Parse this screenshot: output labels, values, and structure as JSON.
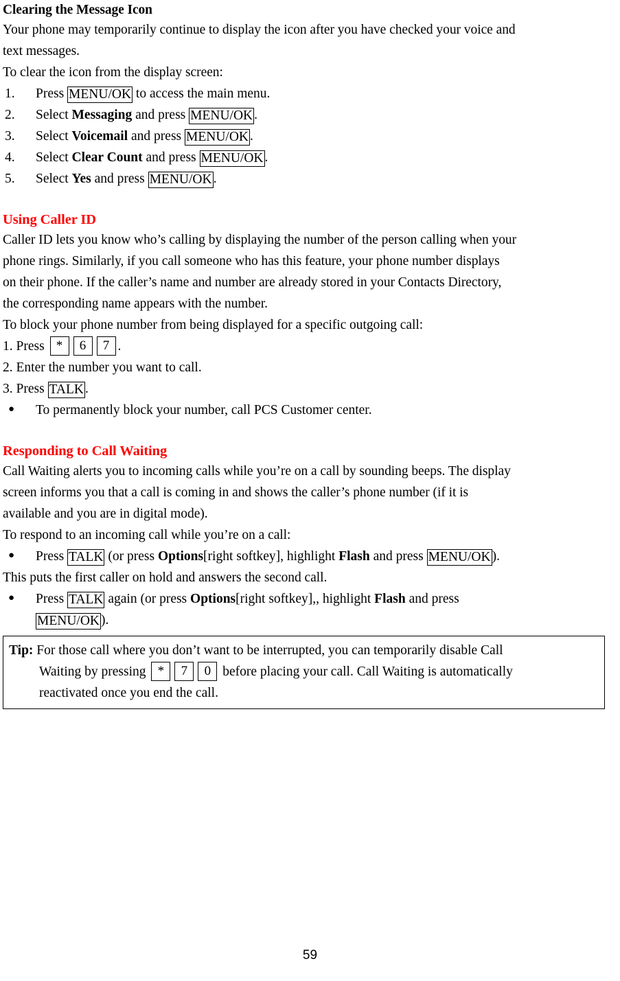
{
  "document": {
    "page_number": "59"
  },
  "sections": [
    {
      "heading": "Clearing the Message Icon",
      "heading_color": "#000000"
    },
    {
      "heading": "Using Caller ID",
      "heading_color": "#FF0000"
    },
    {
      "heading": "Responding to Call Waiting",
      "heading_color": "#FF0000"
    }
  ],
  "clearing_message_icon": {
    "heading": "Clearing the Message Icon",
    "intro_line1": "Your phone may temporarily continue to display the icon after you have checked your voice and",
    "intro_line2": "text messages.",
    "lead_in": "To clear the icon from the display screen:",
    "steps": [
      {
        "num": "1.",
        "pre": "Press ",
        "key": "MENU/OK",
        "post": " to access the main menu."
      },
      {
        "num": "2.",
        "pre": "Select ",
        "bold": "Messaging",
        "mid": " and press ",
        "key": "MENU/OK",
        "post": "."
      },
      {
        "num": "3.",
        "pre": "Select ",
        "bold": "Voicemail",
        "mid": " and press ",
        "key": "MENU/OK",
        "post": "."
      },
      {
        "num": "4.",
        "pre": "Select ",
        "bold": "Clear Count",
        "mid": " and press ",
        "key": "MENU/OK",
        "post": "."
      },
      {
        "num": "5.",
        "pre": "Select ",
        "bold": "Yes",
        "mid": " and press ",
        "key": "MENU/OK",
        "post": "."
      }
    ]
  },
  "using_caller_id": {
    "heading": "Using Caller ID",
    "body_line1": "Caller ID lets you know who’s calling by displaying the number of the person calling when your",
    "body_line2": "phone rings. Similarly, if you call someone who has this feature, your phone number displays",
    "body_line3": "on their phone. If the caller’s name and number are already stored in your Contacts Directory,",
    "body_line4": "the corresponding name appears with the number.",
    "lead_in": "To block your phone number from being displayed for a specific outgoing call:",
    "step1_pre": "1. Press ",
    "step1_keys": [
      "*",
      "6",
      "7"
    ],
    "step1_post": ".",
    "step2": "2. Enter the number you want to call.",
    "step3_pre": "3. Press ",
    "step3_key": "TALK",
    "step3_post": ".",
    "bullet1": "To permanently block your number, call PCS Customer center."
  },
  "responding_to_call_waiting": {
    "heading": "Responding to Call Waiting",
    "body_line1": "Call Waiting alerts you to incoming calls while you’re on a call by sounding beeps. The display",
    "body_line2": "screen informs you that a call is coming in and shows the caller’s phone number (if it is",
    "body_line3": "available and you are in digital mode).",
    "lead_in": "To respond to an incoming call while you’re on a call:",
    "bullet1": {
      "t1": "Press ",
      "key1": "TALK",
      "t2": " (or press ",
      "b1": "Options",
      "t3": "[right softkey], highlight ",
      "b2": "Flash",
      "t4": " and press ",
      "key2": "MENU/OK",
      "t5": ")."
    },
    "mid_note": "This puts the first caller on hold and answers the second call.",
    "bullet2": {
      "t1": "Press ",
      "key1": "TALK",
      "t2": " again (or press ",
      "b1": "Options",
      "t3": "[right softkey],, highlight ",
      "b2": "Flash",
      "t4": " and press",
      "key2": "MENU/OK",
      "t5": ")."
    }
  },
  "tip": {
    "label": "Tip:",
    "line1": " For those call where you don’t want to be interrupted, you can temporarily disable Call",
    "line2_pre": "Waiting by pressing ",
    "line2_keys": [
      "*",
      "7",
      "0"
    ],
    "line2_post": " before placing your call. Call Waiting is automatically",
    "line3": "reactivated once you end the call."
  }
}
